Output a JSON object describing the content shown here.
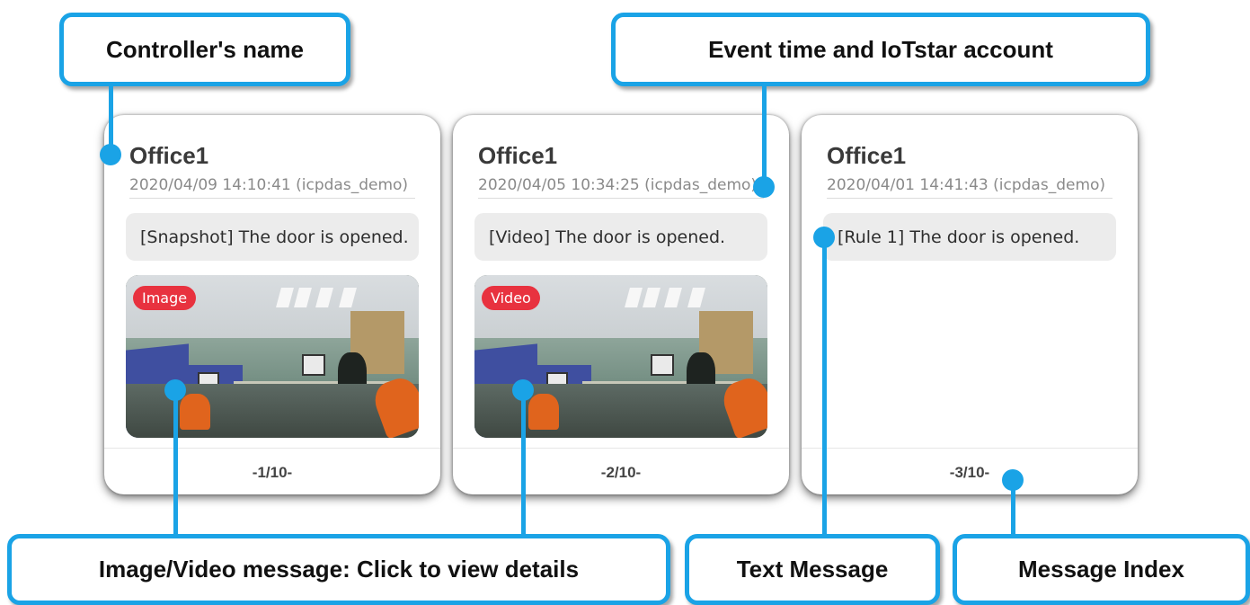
{
  "cards": [
    {
      "controller": "Office1",
      "event_meta": "2020/04/09 14:10:41 (icpdas_demo)",
      "message": "[Snapshot] The door is opened.",
      "media_badge": "Image",
      "index": "-1/10-"
    },
    {
      "controller": "Office1",
      "event_meta": "2020/04/05 10:34:25 (icpdas_demo)",
      "message": "[Video] The door is opened.",
      "media_badge": "Video",
      "index": "-2/10-"
    },
    {
      "controller": "Office1",
      "event_meta": "2020/04/01 14:41:43 (icpdas_demo)",
      "message": "[Rule 1] The door is opened.",
      "index": "-3/10-"
    }
  ],
  "annotations": {
    "controller_name": "Controller's name",
    "event_time": "Event time and IoTstar account",
    "media_message": "Image/Video message: Click to view details",
    "text_message": "Text Message",
    "message_index": "Message Index"
  },
  "colors": {
    "accent": "#1aa3e6",
    "badge": "#e8323f"
  }
}
